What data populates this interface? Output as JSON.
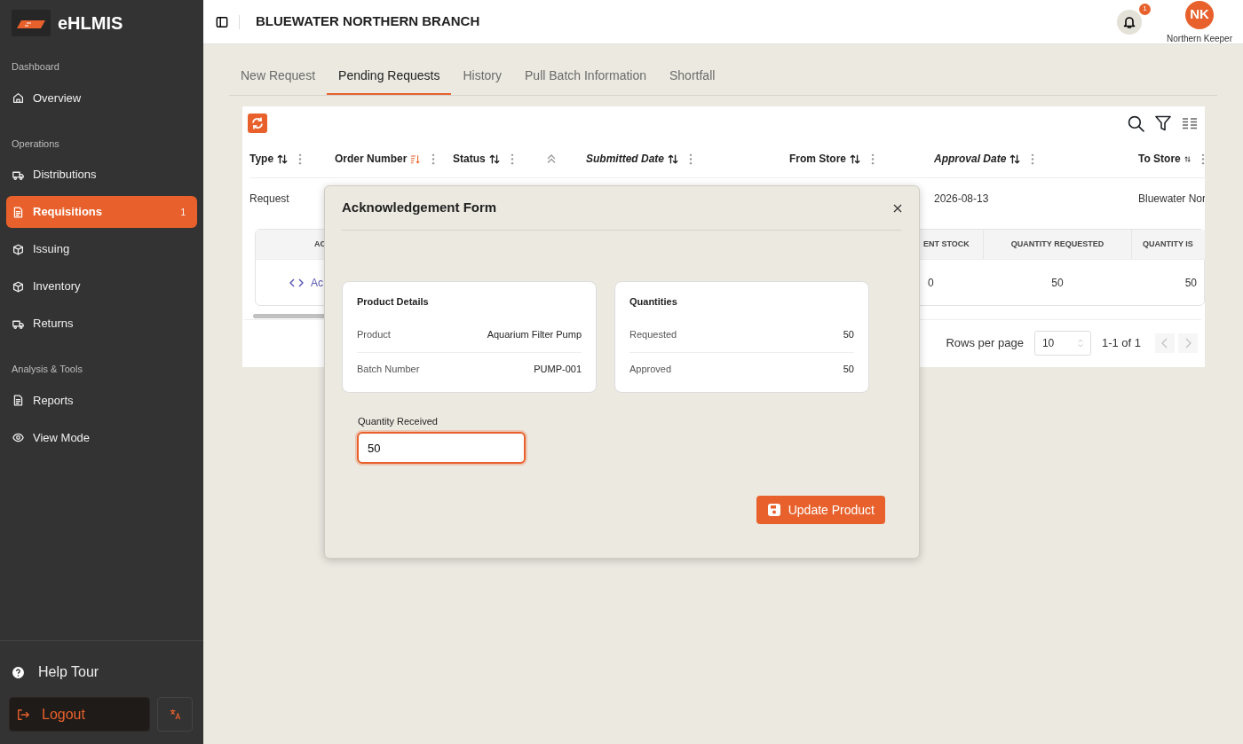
{
  "sidebar": {
    "brand": "eHLMIS",
    "sections": [
      {
        "title": "Dashboard",
        "items": [
          {
            "label": "Overview",
            "kind": "home",
            "selected": false
          }
        ]
      },
      {
        "title": "Operations",
        "items": [
          {
            "label": "Distributions",
            "kind": "truck",
            "selected": false
          },
          {
            "label": "Requisitions",
            "kind": "doc",
            "selected": true,
            "badge": "1"
          },
          {
            "label": "Issuing",
            "kind": "box",
            "selected": false
          },
          {
            "label": "Inventory",
            "kind": "box",
            "selected": false
          },
          {
            "label": "Returns",
            "kind": "truck",
            "selected": false
          }
        ]
      },
      {
        "title": "Analysis & Tools",
        "items": [
          {
            "label": "Reports",
            "kind": "doc",
            "selected": false
          },
          {
            "label": "View Mode",
            "kind": "eye",
            "selected": false
          }
        ]
      }
    ],
    "help": "Help Tour",
    "logout": "Logout"
  },
  "header": {
    "title": "BLUEWATER NORTHERN BRANCH",
    "notifications": "1",
    "avatar": "NK",
    "user": "Northern Keeper"
  },
  "tabs": [
    {
      "label": "New Request",
      "selected": false
    },
    {
      "label": "Pending Requests",
      "selected": true
    },
    {
      "label": "History",
      "selected": false
    },
    {
      "label": "Pull Batch Information",
      "selected": false
    },
    {
      "label": "Shortfall",
      "selected": false
    }
  ],
  "table": {
    "columns": [
      {
        "kind": "text",
        "label": "Type",
        "italic": false,
        "sorted": false
      },
      {
        "kind": "text",
        "label": "Order Number",
        "italic": false,
        "sorted": true
      },
      {
        "kind": "text",
        "label": "Status",
        "italic": false,
        "sorted": false
      },
      {
        "kind": "expand"
      },
      {
        "kind": "text",
        "label": "Submitted Date",
        "italic": true,
        "sorted": false
      },
      {
        "kind": "text",
        "label": "From Store",
        "italic": false,
        "sorted": false
      },
      {
        "kind": "text",
        "label": "Approval Date",
        "italic": true,
        "sorted": false
      },
      {
        "kind": "text",
        "label": "To Store",
        "italic": false,
        "sorted": false
      }
    ],
    "rows": [
      {
        "cells": [
          "Request",
          null,
          null,
          null,
          null,
          null,
          "2026-08-13",
          "Bluewater Nor"
        ]
      }
    ],
    "detail": {
      "columns": [
        "AC",
        "ENT STOCK",
        "QUANTITY REQUESTED",
        "QUANTITY IS"
      ],
      "row": [
        "Ac",
        "0",
        "50",
        "50"
      ]
    },
    "pager": {
      "label": "Rows per page",
      "rows_per_page": "10",
      "range": "1-1 of 1",
      "prev_disabled": true,
      "next_disabled": true
    }
  },
  "modal": {
    "title": "Acknowledgement Form",
    "cards": [
      {
        "title": "Product Details",
        "rows": [
          {
            "label": "Product",
            "value": "Aquarium Filter Pump"
          },
          {
            "label": "Batch Number",
            "value": "PUMP-001"
          }
        ]
      },
      {
        "title": "Quantities",
        "rows": [
          {
            "label": "Requested",
            "value": "50"
          },
          {
            "label": "Approved",
            "value": "50"
          }
        ]
      }
    ],
    "field": {
      "label": "Quantity Received",
      "value": "50"
    },
    "button": "Update Product"
  }
}
